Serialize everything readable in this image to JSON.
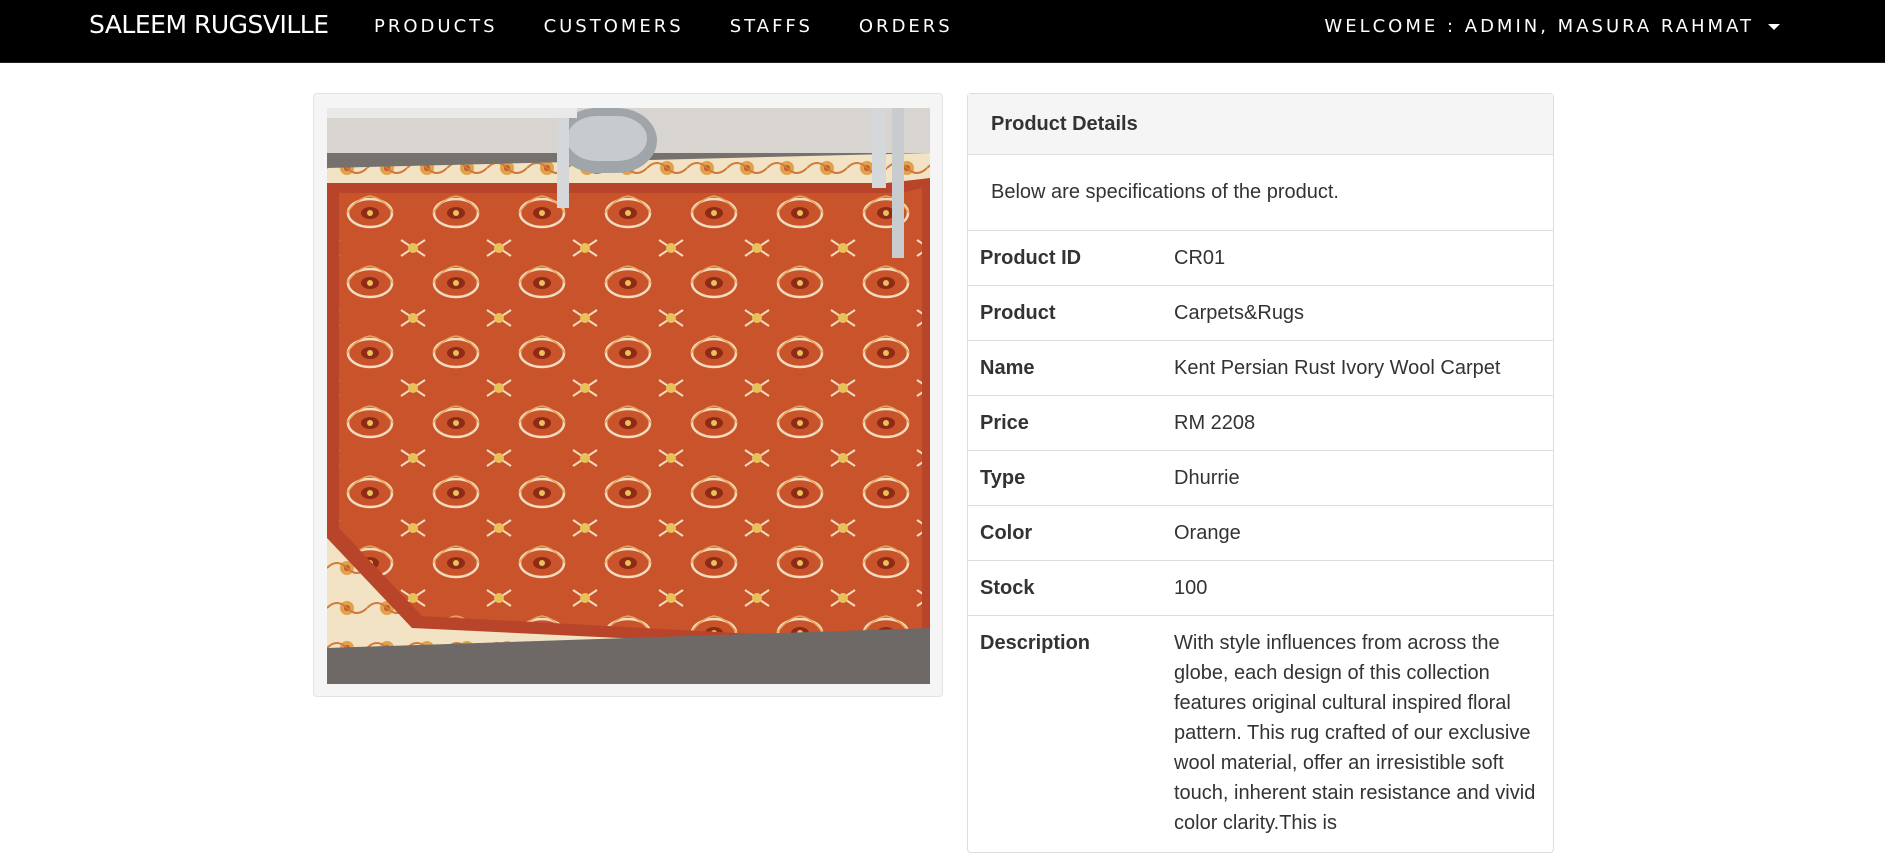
{
  "navbar": {
    "brand": "SALEEM RUGSVILLE",
    "links": [
      "PRODUCTS",
      "CUSTOMERS",
      "STAFFS",
      "ORDERS"
    ],
    "welcome": "WELCOME : ADMIN, MASURA RAHMAT"
  },
  "product_image": {
    "alt": "Orange Persian style carpet"
  },
  "details": {
    "heading": "Product Details",
    "intro": "Below are specifications of the product.",
    "rows": [
      {
        "key": "Product ID",
        "value": "CR01"
      },
      {
        "key": "Product",
        "value": "Carpets&Rugs"
      },
      {
        "key": "Name",
        "value": "Kent Persian Rust Ivory Wool Carpet"
      },
      {
        "key": "Price",
        "value": "RM 2208"
      },
      {
        "key": "Type",
        "value": "Dhurrie"
      },
      {
        "key": "Color",
        "value": "Orange"
      },
      {
        "key": "Stock",
        "value": "100"
      },
      {
        "key": "Description",
        "value": "With style influences from across the globe, each design of this collection features original cultural inspired floral pattern. This rug crafted of our exclusive wool material, offer an irresistible soft touch, inherent stain resistance and vivid color clarity.This is"
      }
    ]
  },
  "colors": {
    "nav_bg": "#000000",
    "rug_field": "#c9542c",
    "rug_border": "#f1e3c4"
  }
}
